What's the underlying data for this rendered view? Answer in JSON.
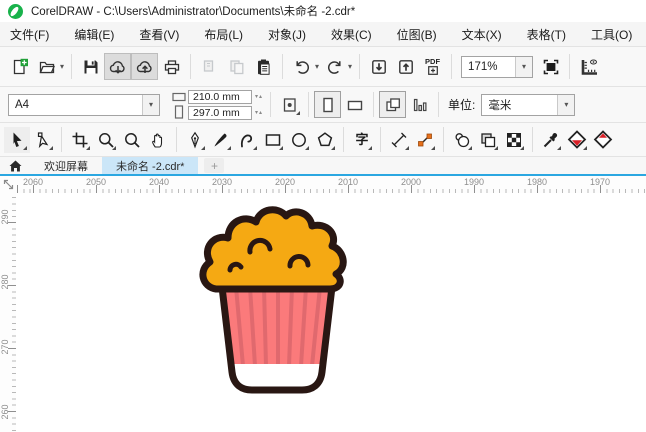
{
  "window": {
    "title": "CorelDRAW - C:\\Users\\Administrator\\Documents\\未命名 -2.cdr*"
  },
  "menu": {
    "items": [
      "文件(F)",
      "编辑(E)",
      "查看(V)",
      "布局(L)",
      "对象(J)",
      "效果(C)",
      "位图(B)",
      "文本(X)",
      "表格(T)",
      "工具(O)"
    ]
  },
  "toolbar": {
    "zoom_level": "171%",
    "pdf_label": "PDF",
    "buttons": [
      {
        "name": "new-document",
        "enabled": true
      },
      {
        "name": "open",
        "enabled": true
      },
      {
        "name": "save",
        "enabled": true
      },
      {
        "name": "save-to-cloud",
        "enabled": true,
        "pressed": true
      },
      {
        "name": "open-from-cloud",
        "enabled": true,
        "pressed": true
      },
      {
        "name": "print",
        "enabled": true
      },
      {
        "name": "cut",
        "enabled": false
      },
      {
        "name": "copy",
        "enabled": false
      },
      {
        "name": "paste",
        "enabled": true
      },
      {
        "name": "undo",
        "enabled": true
      },
      {
        "name": "redo",
        "enabled": true
      },
      {
        "name": "import",
        "enabled": true
      },
      {
        "name": "export",
        "enabled": true
      },
      {
        "name": "publish-to-pdf",
        "enabled": true
      },
      {
        "name": "zoom-levels",
        "value": "171%"
      },
      {
        "name": "full-screen-preview",
        "enabled": true
      },
      {
        "name": "show-rulers",
        "enabled": true
      }
    ]
  },
  "property_bar": {
    "page_size": "A4",
    "page_width": "210.0 mm",
    "page_height": "297.0 mm",
    "orientation": "portrait",
    "units_label": "单位:",
    "units_value": "毫米",
    "buttons": [
      "autofit-page",
      "portrait",
      "landscape",
      "all-pages",
      "current-page"
    ]
  },
  "toolbox": {
    "selected": "pick",
    "text_tool_glyph": "字",
    "tools": [
      "pick",
      "shape",
      "crop",
      "zoom",
      "zoom-out",
      "pan",
      "pen",
      "artistic-media",
      "b-spline",
      "rectangle",
      "ellipse",
      "polygon",
      "text",
      "dimension",
      "connector",
      "drop-shadow",
      "transparency",
      "pattern-fill",
      "color-eyedropper",
      "interactive-fill",
      "smart-fill"
    ]
  },
  "tabs": {
    "welcome": "欢迎屏幕",
    "document": "未命名 -2.cdr*",
    "new_tab": "+",
    "active": "document"
  },
  "rulers": {
    "horizontal": {
      "labels": [
        "2060",
        "2050",
        "2040",
        "2030",
        "2020",
        "2010",
        "2000",
        "1990",
        "1980",
        "1970"
      ]
    },
    "vertical": {
      "labels": [
        "290",
        "280",
        "270",
        "260"
      ]
    }
  },
  "canvas": {
    "object": "popcorn-bucket-illustration",
    "colors": {
      "popcorn": "#F5A913",
      "cup": "#FB7A7B",
      "stripe": "#E0696E",
      "outline": "#291713",
      "band": "#FFFFFF"
    }
  },
  "accent": {
    "tab_underline": "#2BA7E1",
    "active_tab_bg": "#CBE6F8",
    "logo_green": "#19B24B"
  }
}
